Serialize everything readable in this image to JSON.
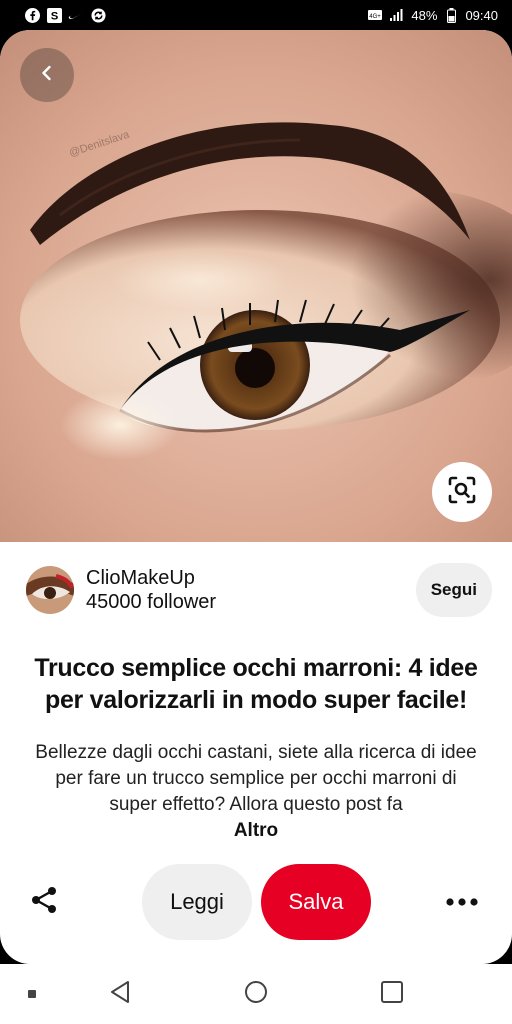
{
  "status_bar": {
    "battery": "48%",
    "time": "09:40",
    "left_icons": [
      "facebook-icon",
      "s-app-icon",
      "nike-icon",
      "sync-icon"
    ]
  },
  "hero": {
    "watermark": "@Denitslava",
    "back_icon": "chevron-left-icon",
    "lens_icon": "visual-search-icon"
  },
  "creator": {
    "name": "ClioMakeUp",
    "followers": "45000 follower",
    "follow_label": "Segui"
  },
  "pin": {
    "title": "Trucco semplice occhi marroni: 4 idee per valorizzarli in modo super facile!",
    "description": "Bellezze dagli occhi castani, siete alla ricerca di idee per fare un trucco semplice per occhi marroni di super effetto? Allora questo post fa",
    "more_label": "Altro"
  },
  "actions": {
    "read_label": "Leggi",
    "save_label": "Salva",
    "share_icon": "share-icon",
    "more_icon": "more-dots-icon"
  },
  "colors": {
    "accent": "#e60023",
    "button_bg": "#efefef"
  }
}
